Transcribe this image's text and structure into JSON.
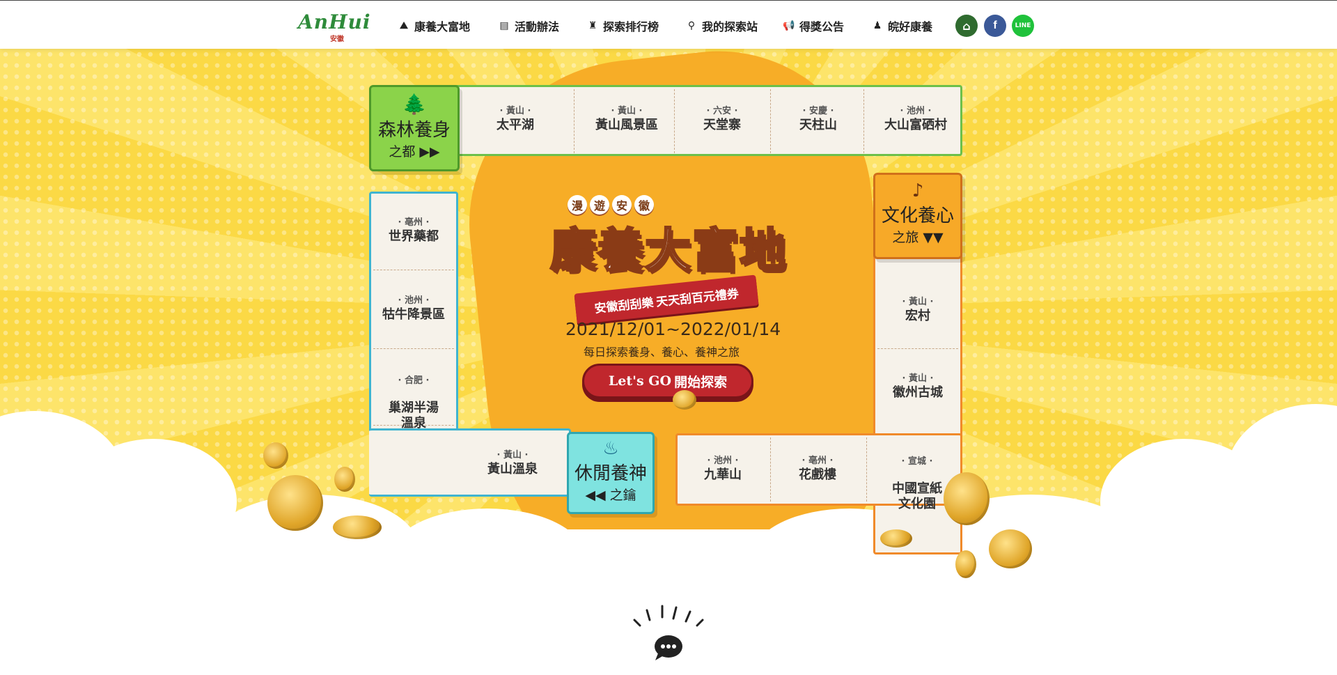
{
  "nav": {
    "logo_script": "AnHui",
    "logo_sub": "安徽",
    "items": [
      {
        "label": "康養大富地",
        "icon": "hiker-icon"
      },
      {
        "label": "活動辦法",
        "icon": "document-icon"
      },
      {
        "label": "探索排行榜",
        "icon": "trophy-icon"
      },
      {
        "label": "我的探索站",
        "icon": "map-pin-icon"
      },
      {
        "label": "得獎公告",
        "icon": "megaphone-icon"
      },
      {
        "label": "皖好康養",
        "icon": "meditation-icon"
      }
    ],
    "social": [
      {
        "name": "home-icon",
        "glyph": "⌂",
        "color": "#2f6b2f"
      },
      {
        "name": "facebook-icon",
        "glyph": "f",
        "color": "#3b5998"
      },
      {
        "name": "line-icon",
        "glyph": "LINE",
        "color": "#1fc23b"
      }
    ]
  },
  "hero": {
    "badge": [
      "漫",
      "遊",
      "安",
      "徽"
    ],
    "title": "康養大富地",
    "ribbon_left": "安徽刮刮樂",
    "ribbon_right": "天天刮百元禮券",
    "dates": "2021/12/01~2022/01/14",
    "slogan": "每日探索養身、養心、養神之旅",
    "go_en": "Let's GO",
    "go_zh": "開始探索"
  },
  "zones": {
    "forest": {
      "t1": "森林養身",
      "t2": "之都 ▶▶",
      "color": "#8bd34a"
    },
    "culture": {
      "t1": "文化養心",
      "t2": "之旅 ▼▼",
      "color": "#f7a928"
    },
    "leisure": {
      "t1": "休閒養神",
      "t2": "◀◀ 之鑰",
      "color": "#7fe3e0"
    }
  },
  "top_cells": [
    {
      "reg": "· 黃山 ·",
      "nm": "太平湖"
    },
    {
      "reg": "· 黃山 ·",
      "nm": "黃山風景區"
    },
    {
      "reg": "· 六安 ·",
      "nm": "天堂寨"
    },
    {
      "reg": "· 安慶 ·",
      "nm": "天柱山"
    },
    {
      "reg": "· 池州 ·",
      "nm": "大山富硒村"
    }
  ],
  "left_cells": [
    {
      "reg": "· 亳州 ·",
      "nm": "世界藥都"
    },
    {
      "reg": "· 池州 ·",
      "nm": "牯牛降景區"
    },
    {
      "reg": "· 合肥 ·",
      "nm": "巢湖半湯\n溫泉"
    }
  ],
  "bottom_left_cell": {
    "reg": "· 黃山 ·",
    "nm": "黃山溫泉"
  },
  "right_cells": [
    {
      "reg": "· 黃山 ·",
      "nm": "宏村"
    },
    {
      "reg": "· 黃山 ·",
      "nm": "徽州古城"
    }
  ],
  "bottom_right_cells": [
    {
      "reg": "· 池州 ·",
      "nm": "九華山"
    },
    {
      "reg": "· 亳州 ·",
      "nm": "花戲樓"
    },
    {
      "reg": "· 宣城 ·",
      "nm": "中國宣紙\n文化園"
    }
  ]
}
